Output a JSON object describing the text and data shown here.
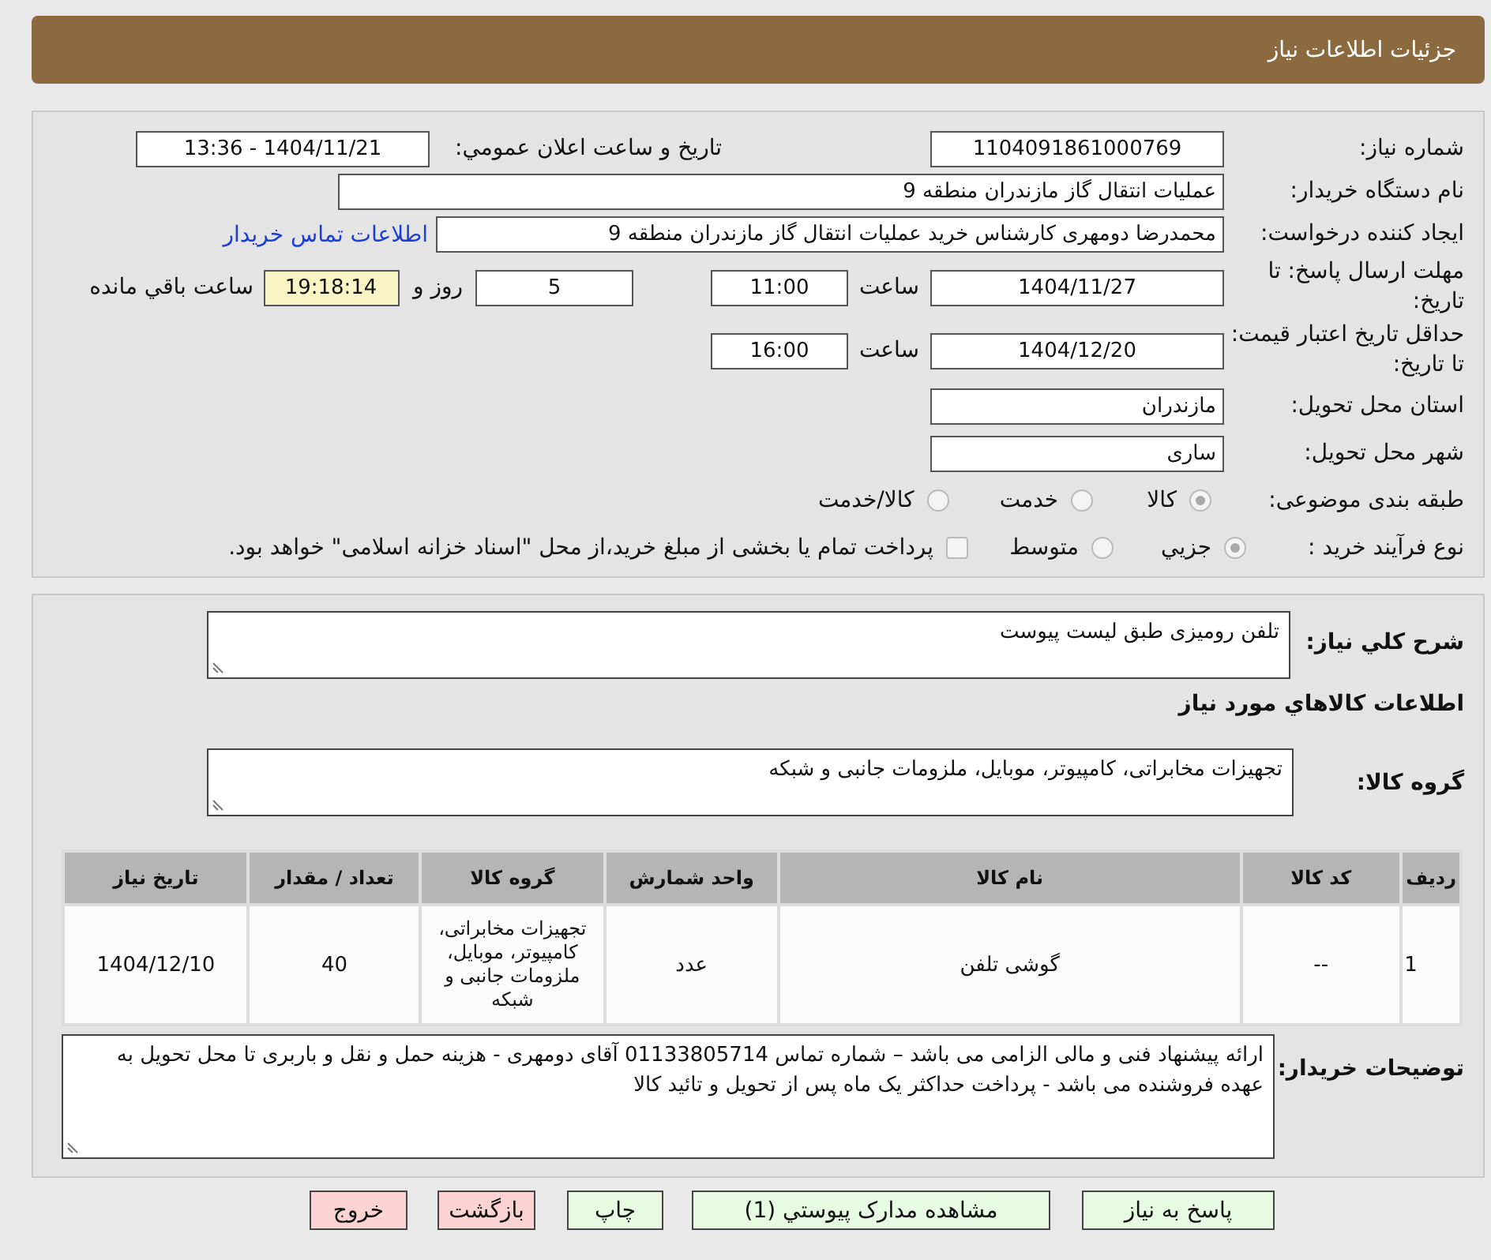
{
  "header": {
    "title": "جزئیات اطلاعات نیاز"
  },
  "need_number": {
    "label": "شماره نیاز:",
    "value": "1104091861000769"
  },
  "announce": {
    "label": "تاریخ و ساعت اعلان عمومي:",
    "value": "1404/11/21 - 13:36"
  },
  "buyer": {
    "label": "نام دستگاه خریدار:",
    "value": "عملیات انتقال گاز مازندران منطقه 9"
  },
  "requester": {
    "label": "ایجاد کننده درخواست:",
    "value": "محمدرضا دومهری کارشناس خرید عملیات انتقال گاز مازندران منطقه 9",
    "link": "اطلاعات تماس خریدار"
  },
  "deadline": {
    "label": "مهلت ارسال پاسخ: تا تاریخ:",
    "date": "1404/11/27",
    "time_label": "ساعت",
    "time": "11:00",
    "days": "5",
    "days_label": "روز و",
    "remaining": "19:18:14",
    "remaining_label": "ساعت باقي مانده"
  },
  "validity": {
    "label": "حداقل تاریخ اعتبار قیمت: تا تاریخ:",
    "date": "1404/12/20",
    "time_label": "ساعت",
    "time": "16:00"
  },
  "province": {
    "label": "استان محل تحویل:",
    "value": "مازندران"
  },
  "city": {
    "label": "شهر محل تحویل:",
    "value": "ساری"
  },
  "category": {
    "label": "طبقه بندی موضوعی:",
    "options": [
      {
        "label": "کالا",
        "selected": true
      },
      {
        "label": "خدمت",
        "selected": false
      },
      {
        "label": "کالا/خدمت",
        "selected": false
      }
    ]
  },
  "process": {
    "label": "نوع فرآیند خرید :",
    "options": [
      {
        "label": "جزيي",
        "selected": true
      },
      {
        "label": "متوسط",
        "selected": false
      }
    ],
    "treasury": {
      "label": "پرداخت تمام یا بخشی از مبلغ خرید،از محل \"اسناد خزانه اسلامی\" خواهد بود.",
      "checked": false
    }
  },
  "summary": {
    "label": "شرح کلي نیاز:",
    "value": "تلفن رومیزی طبق لیست پیوست"
  },
  "goods_heading": "اطلاعات کالاهاي مورد نیاز",
  "goods_group": {
    "label": "گروه کالا:",
    "value": "تجهیزات مخابراتی، کامپیوتر، موبایل، ملزومات جانبی و شبکه"
  },
  "table": {
    "columns": [
      "ردیف",
      "کد کالا",
      "نام کالا",
      "واحد شمارش",
      "گروه کالا",
      "تعداد / مقدار",
      "تاریخ نیاز"
    ],
    "rows": [
      [
        "1",
        "--",
        "گوشی تلفن",
        "عدد",
        "تجهیزات مخابراتی، کامپیوتر، موبایل، ملزومات جانبی و شبکه",
        "40",
        "1404/12/10"
      ]
    ]
  },
  "notes": {
    "label": "توضیحات خریدار:",
    "value": "ارائه پیشنهاد فنی  و مالی الزامی می باشد – شماره تماس 01133805714 آقای دومهری  - هزینه حمل و نقل و باربری تا محل تحویل به عهده فروشنده می باشد - پرداخت حداکثر یک ماه پس از تحویل و تائید کالا"
  },
  "buttons": [
    {
      "label": "پاسخ به نیاز",
      "kind": "primary"
    },
    {
      "label": "مشاهده مدارک پیوستي (1)",
      "kind": "primary"
    },
    {
      "label": "چاپ",
      "kind": "primary"
    },
    {
      "label": "بازگشت",
      "kind": "danger"
    },
    {
      "label": "خروج",
      "kind": "danger"
    }
  ]
}
